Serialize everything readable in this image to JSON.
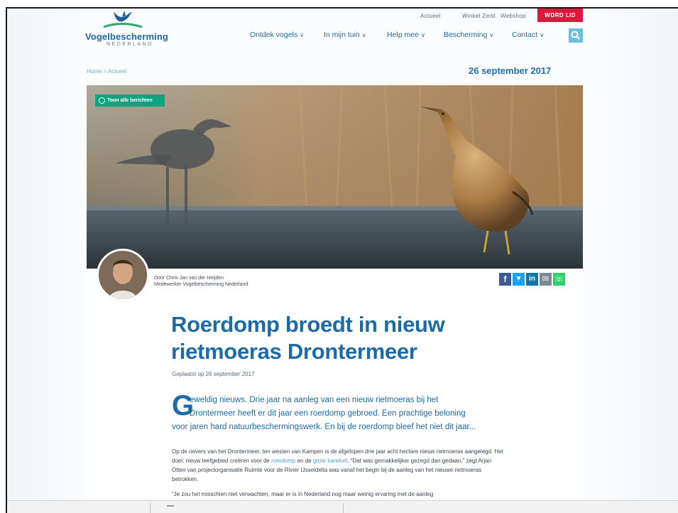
{
  "site": {
    "name": "Vogelbescherming",
    "subname": "NEDERLAND"
  },
  "topnav": {
    "actueel": "Actueel",
    "winkel": "Winkel Zeist",
    "webshop": "Webshop",
    "word_lid": "WORD LID"
  },
  "mainnav": [
    {
      "label": "Ontdek vogels"
    },
    {
      "label": "In mijn tuin"
    },
    {
      "label": "Help mee"
    },
    {
      "label": "Bescherming"
    },
    {
      "label": "Contact"
    }
  ],
  "breadcrumb": "Home > Actueel",
  "date_banner": "26 september 2017",
  "hero": {
    "toon_button": "Toon alle berichten"
  },
  "author": {
    "line1": "Door Chris-Jan van der Heijden",
    "line2": "Medewerker Vogelbescherming Nederland"
  },
  "article": {
    "title": "Roerdomp broedt in nieuw rietmoeras Drontermeer",
    "posted": "Geplaatst op 26 september 2017",
    "dropcap": "G",
    "lead_line1": "eweldig nieuws. Drie jaar na aanleg van een nieuw rietmoeras bij het",
    "lead_line2": "Drontermeer heeft er dit jaar een roerdomp gebroed. Een prachtige beloning",
    "lead_line3": "voor jaren hard natuurbeschermingswerk. En bij de roerdomp bleef het niet dit jaar...",
    "p1_a": "Op de oevers van het Drontermeer, ten westen van Kampen is de afgelopen drie jaar acht hectare nieuw rietmoeras aangelegd. Het doel: nieuw leefgebied creëren voor de ",
    "p1_link1": "roerdomp",
    "p1_b": " en de ",
    "p1_link2": "grote karekiet",
    "p1_c": ". “Dat was gemakkelijker gezegd dan gedaan,” zegt Arjan Otten van projectorganisatie Ruimte voor de Rivier IJsseldelta was vanaf het begin bij de aanleg van het nieuwe rietmoeras betrokken.",
    "p2": "“Je zou het misschien niet verwachten, maar er is in Nederland nog maar weinig ervaring met de aanleg"
  },
  "colors": {
    "brand_blue": "#1d6aa8",
    "accent_red": "#e0163a",
    "green": "#10a37f",
    "facebook": "#3b5998",
    "twitter": "#1da1f2",
    "linkedin": "#0e76a8",
    "mail": "#7d8a96",
    "whatsapp": "#25d366"
  },
  "icons": [
    "bird-logo-icon",
    "search-icon",
    "clock-icon",
    "chevron-down-icon",
    "facebook-icon",
    "twitter-icon",
    "linkedin-icon",
    "mail-icon",
    "whatsapp-icon"
  ]
}
